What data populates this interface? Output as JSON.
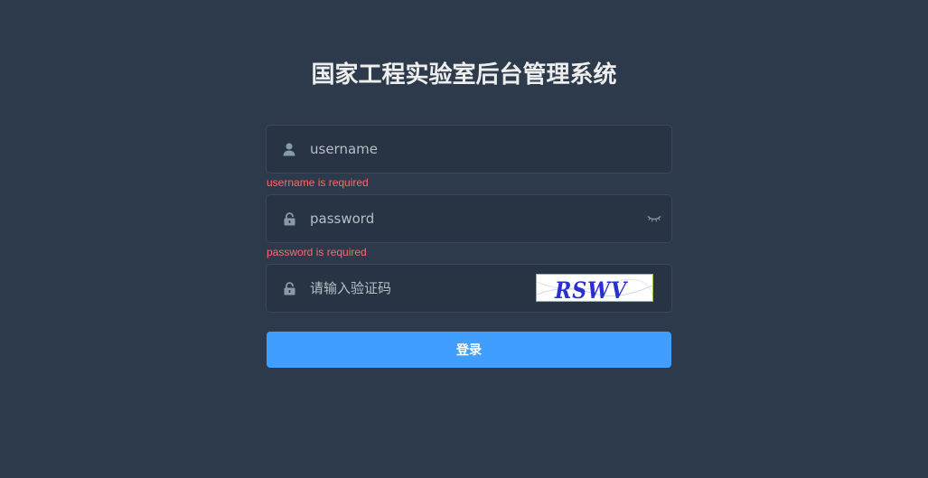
{
  "page": {
    "title": "国家工程实验室后台管理系统"
  },
  "form": {
    "username": {
      "placeholder": "username",
      "value": "",
      "error": "username is required"
    },
    "password": {
      "placeholder": "password",
      "value": "",
      "error": "password is required"
    },
    "captcha": {
      "placeholder": "请输入验证码",
      "value": "",
      "image_text": "RSWV"
    },
    "submit_label": "登录"
  },
  "colors": {
    "background": "#2d3a4b",
    "field_background": "#283443",
    "primary": "#409eff",
    "error": "#f56c6c"
  },
  "icons": {
    "username": "user-icon",
    "password": "lock-icon",
    "captcha": "lock-icon",
    "toggle_password": "eye-closed-icon"
  }
}
